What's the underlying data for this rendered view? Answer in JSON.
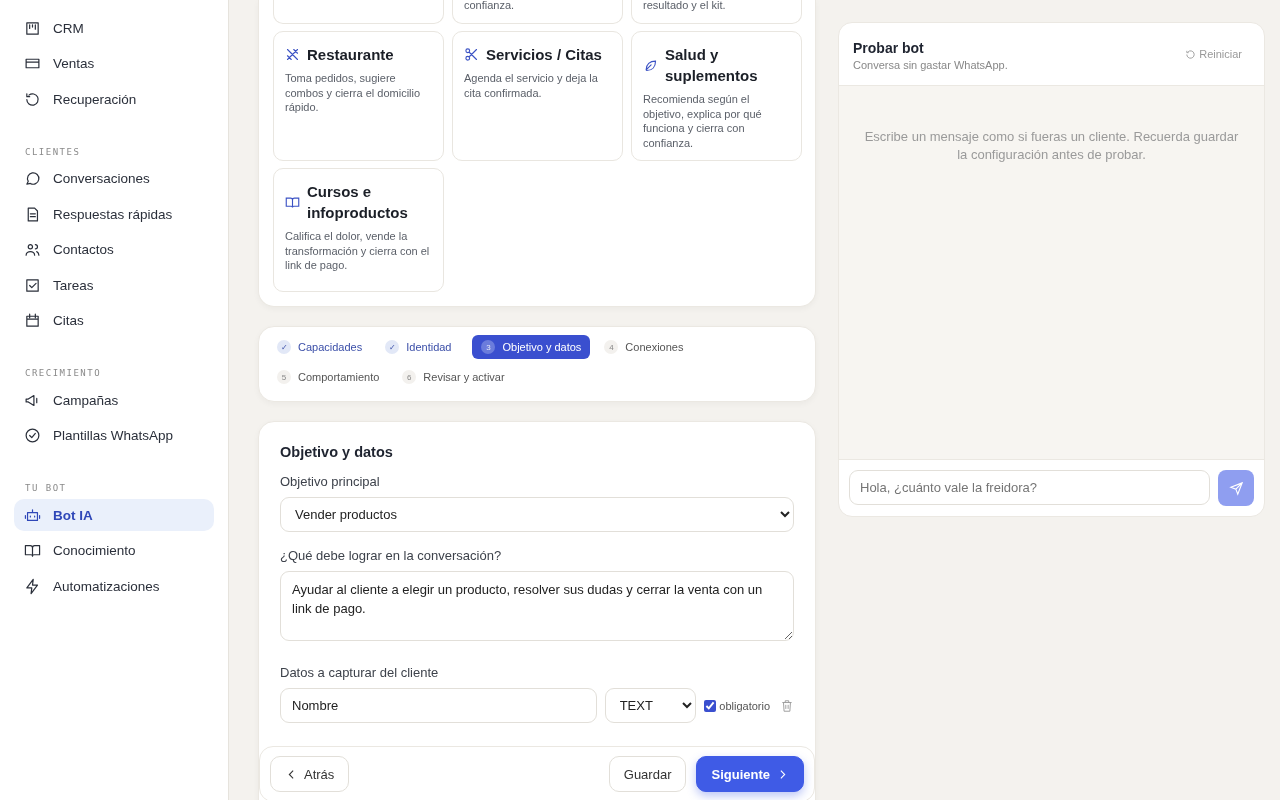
{
  "sidebar": {
    "groups": [
      {
        "items": [
          {
            "label": "CRM",
            "selected": false
          },
          {
            "label": "Ventas",
            "selected": false
          },
          {
            "label": "Recuperación",
            "selected": false
          }
        ]
      },
      {
        "title": "CLIENTES",
        "items": [
          {
            "label": "Conversaciones",
            "selected": false
          },
          {
            "label": "Respuestas rápidas",
            "selected": false
          },
          {
            "label": "Contactos",
            "selected": false
          },
          {
            "label": "Tareas",
            "selected": false
          },
          {
            "label": "Citas",
            "selected": false
          }
        ]
      },
      {
        "title": "CRECIMIENTO",
        "items": [
          {
            "label": "Campañas",
            "selected": false
          },
          {
            "label": "Plantillas WhatsApp",
            "selected": false
          }
        ]
      },
      {
        "title": "TU BOT",
        "items": [
          {
            "label": "Bot IA",
            "selected": true
          },
          {
            "label": "Conocimiento",
            "selected": false
          },
          {
            "label": "Automatizaciones",
            "selected": false
          }
        ]
      }
    ]
  },
  "templates": [
    {
      "cut": true
    },
    {
      "description": "confianza.",
      "cut": true
    },
    {
      "description": "resultado y el kit.",
      "cut": true
    },
    {
      "title": "Restaurante",
      "description": "Toma pedidos, sugiere combos y cierra el domicilio rápido.",
      "cut": false
    },
    {
      "title": "Servicios / Citas",
      "description": "Agenda el servicio y deja la cita confirmada.",
      "cut": false
    },
    {
      "title": "Salud y suplementos",
      "description": "Recomienda según el objetivo, explica por qué funciona y cierra con confianza.",
      "cut": false
    },
    {
      "title": "Cursos e infoproductos",
      "description": "Califica el dolor, vende la transformación y cierra con el link de pago.",
      "cut": false
    }
  ],
  "steps": [
    {
      "mark": "✓",
      "label": "Capacidades",
      "done": true,
      "selected": false
    },
    {
      "mark": "✓",
      "label": "Identidad",
      "done": true,
      "selected": false
    },
    {
      "mark": "3",
      "label": "Objetivo y datos",
      "done": false,
      "selected": true
    },
    {
      "mark": "4",
      "label": "Conexiones",
      "done": false,
      "selected": false
    },
    {
      "mark": "5",
      "label": "Comportamiento",
      "done": false,
      "selected": false
    },
    {
      "mark": "6",
      "label": "Revisar y activar",
      "done": false,
      "selected": false
    }
  ],
  "form": {
    "title": "Objetivo y datos",
    "goal_label": "Objetivo principal",
    "goal_value": "Vender productos",
    "achieve_label": "¿Qué debe lograr en la conversación?",
    "achieve_value": "Ayudar al cliente a elegir un producto, resolver sus dudas y cerrar la venta con un link de pago.",
    "capture_label": "Datos a capturar del cliente",
    "fields": [
      {
        "value": "Nombre",
        "type": "TEXT",
        "required": true,
        "required_label": "obligatorio"
      }
    ]
  },
  "footer": {
    "back": "Atrás",
    "save": "Guardar",
    "next": "Siguiente"
  },
  "test_panel": {
    "title": "Probar bot",
    "subtitle": "Conversa sin gastar WhatsApp.",
    "reset": "Reiniciar",
    "empty_text": "Escribe un mensaje como si fueras un cliente. Recuerda guardar la configuración antes de probar.",
    "placeholder": "Hola, ¿cuánto vale la freidora?"
  }
}
